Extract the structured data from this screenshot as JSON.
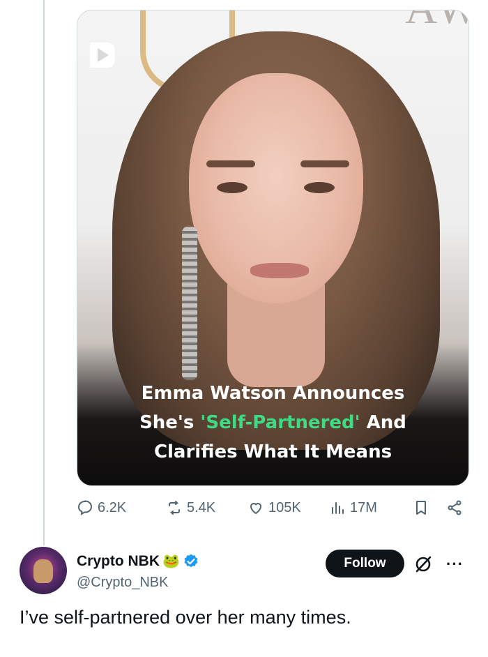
{
  "media": {
    "background_sign": "AWA",
    "headline_line1": "Emma Watson Announces",
    "headline_line2_prefix": "She's ",
    "headline_highlight": "'Self-Partnered'",
    "headline_line2_suffix": " And",
    "headline_line3": "Clarifies What It Means",
    "highlight_color": "#3ddc84"
  },
  "actions": {
    "replies": "6.2K",
    "reposts": "5.4K",
    "likes": "105K",
    "views": "17M"
  },
  "reply": {
    "display_name": "Crypto NBK",
    "name_emoji": "🐸",
    "handle": "@Crypto_NBK",
    "follow_label": "Follow",
    "more_label": "···",
    "text": "I’ve self-partnered over her many times."
  },
  "colors": {
    "text_primary": "#0f1419",
    "text_secondary": "#536471",
    "verified_blue": "#1d9bf0",
    "thread_line": "#cfd9de"
  }
}
